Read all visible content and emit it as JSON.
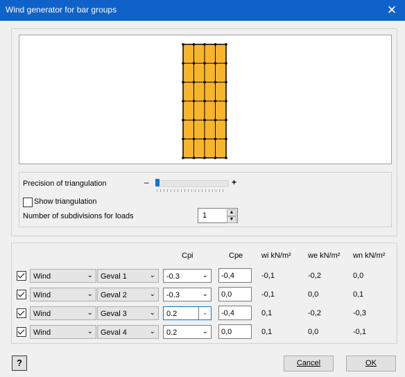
{
  "window": {
    "title": "Wind generator for bar groups",
    "close_glyph": "✕"
  },
  "preview": {
    "structure_color": "#f7b52c",
    "structure_columns": 4,
    "structure_rows": 6
  },
  "settings": {
    "precision_label": "Precision of triangulation",
    "minus": "–",
    "plus": "+",
    "precision_value_fraction": 0.02,
    "show_triangulation_label": "Show triangulation",
    "show_triangulation_checked": false,
    "subdivisions_label": "Number of subdivisions for loads",
    "subdivisions_value": "1"
  },
  "table": {
    "headers": {
      "cpi": "Cpi",
      "cpe": "Cpe",
      "wi": "wi  kN/m²",
      "we": "we kN/m²",
      "wn": "wn kN/m²"
    },
    "rows": [
      {
        "checked": true,
        "type": "Wind",
        "case": "Geval 1",
        "cpi": "-0.3",
        "cpe": "-0,4",
        "wi": "-0,1",
        "we": "-0,2",
        "wn": "0,0"
      },
      {
        "checked": true,
        "type": "Wind",
        "case": "Geval 2",
        "cpi": "-0.3",
        "cpe": "0,0",
        "wi": "-0,1",
        "we": "0,0",
        "wn": "0,1"
      },
      {
        "checked": true,
        "type": "Wind",
        "case": "Geval 3",
        "cpi": "0.2",
        "cpe": "-0,4",
        "wi": "0,1",
        "we": "-0,2",
        "wn": "-0,3"
      },
      {
        "checked": true,
        "type": "Wind",
        "case": "Geval 4",
        "cpi": "0.2",
        "cpe": "0,0",
        "wi": "0,1",
        "we": "0,0",
        "wn": "-0,1"
      }
    ]
  },
  "footer": {
    "help": "?",
    "cancel": "Cancel",
    "ok": "OK"
  }
}
